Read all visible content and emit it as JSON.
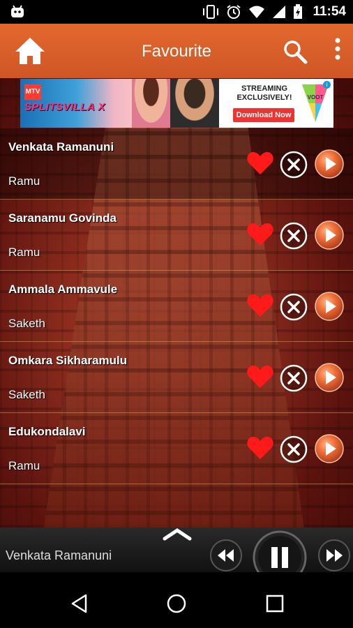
{
  "status": {
    "time": "11:54"
  },
  "appbar": {
    "title": "Favourite"
  },
  "ad": {
    "mtv_logo": "MTV",
    "brand": "SPLITSVILLA X",
    "headline_line1": "STREAMING",
    "headline_line2": "EXCLUSIVELY!",
    "cta": "Download Now",
    "partner": "VOOT",
    "info": "i"
  },
  "favourites": [
    {
      "song": "Venkata Ramanuni",
      "artist": "Ramu"
    },
    {
      "song": "Saranamu Govinda",
      "artist": "Ramu"
    },
    {
      "song": "Ammala Ammavule",
      "artist": "Saketh"
    },
    {
      "song": "Omkara Sikharamulu",
      "artist": "Saketh"
    },
    {
      "song": "Edukondalavi",
      "artist": "Ramu"
    }
  ],
  "player": {
    "now_playing": "Venkata Ramanuni"
  },
  "colors": {
    "appbar": "#dc6029",
    "heart": "#ff1a1a",
    "play_orange": "#e8622a"
  }
}
